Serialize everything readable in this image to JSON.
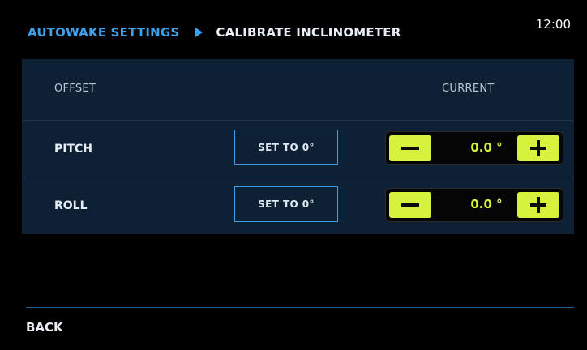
{
  "header": {
    "breadcrumb_parent": "AUTOWAKE SETTINGS",
    "breadcrumb_current": "CALIBRATE INCLINOMETER",
    "time": "12:00"
  },
  "table": {
    "col_offset": "OFFSET",
    "col_current": "CURRENT",
    "rows": [
      {
        "label": "PITCH",
        "button": "SET TO 0°",
        "value": "0.0 °"
      },
      {
        "label": "ROLL",
        "button": "SET TO 0°",
        "value": "0.0 °"
      }
    ]
  },
  "footer": {
    "back_label": "BACK"
  },
  "colors": {
    "accent_blue": "#3fa0e8",
    "panel_bg": "#0d2034",
    "stepper_green": "#d6f23d"
  },
  "icons": {
    "breadcrumb_separator": "triangle-right-icon",
    "decrement": "minus-icon",
    "increment": "plus-icon"
  }
}
